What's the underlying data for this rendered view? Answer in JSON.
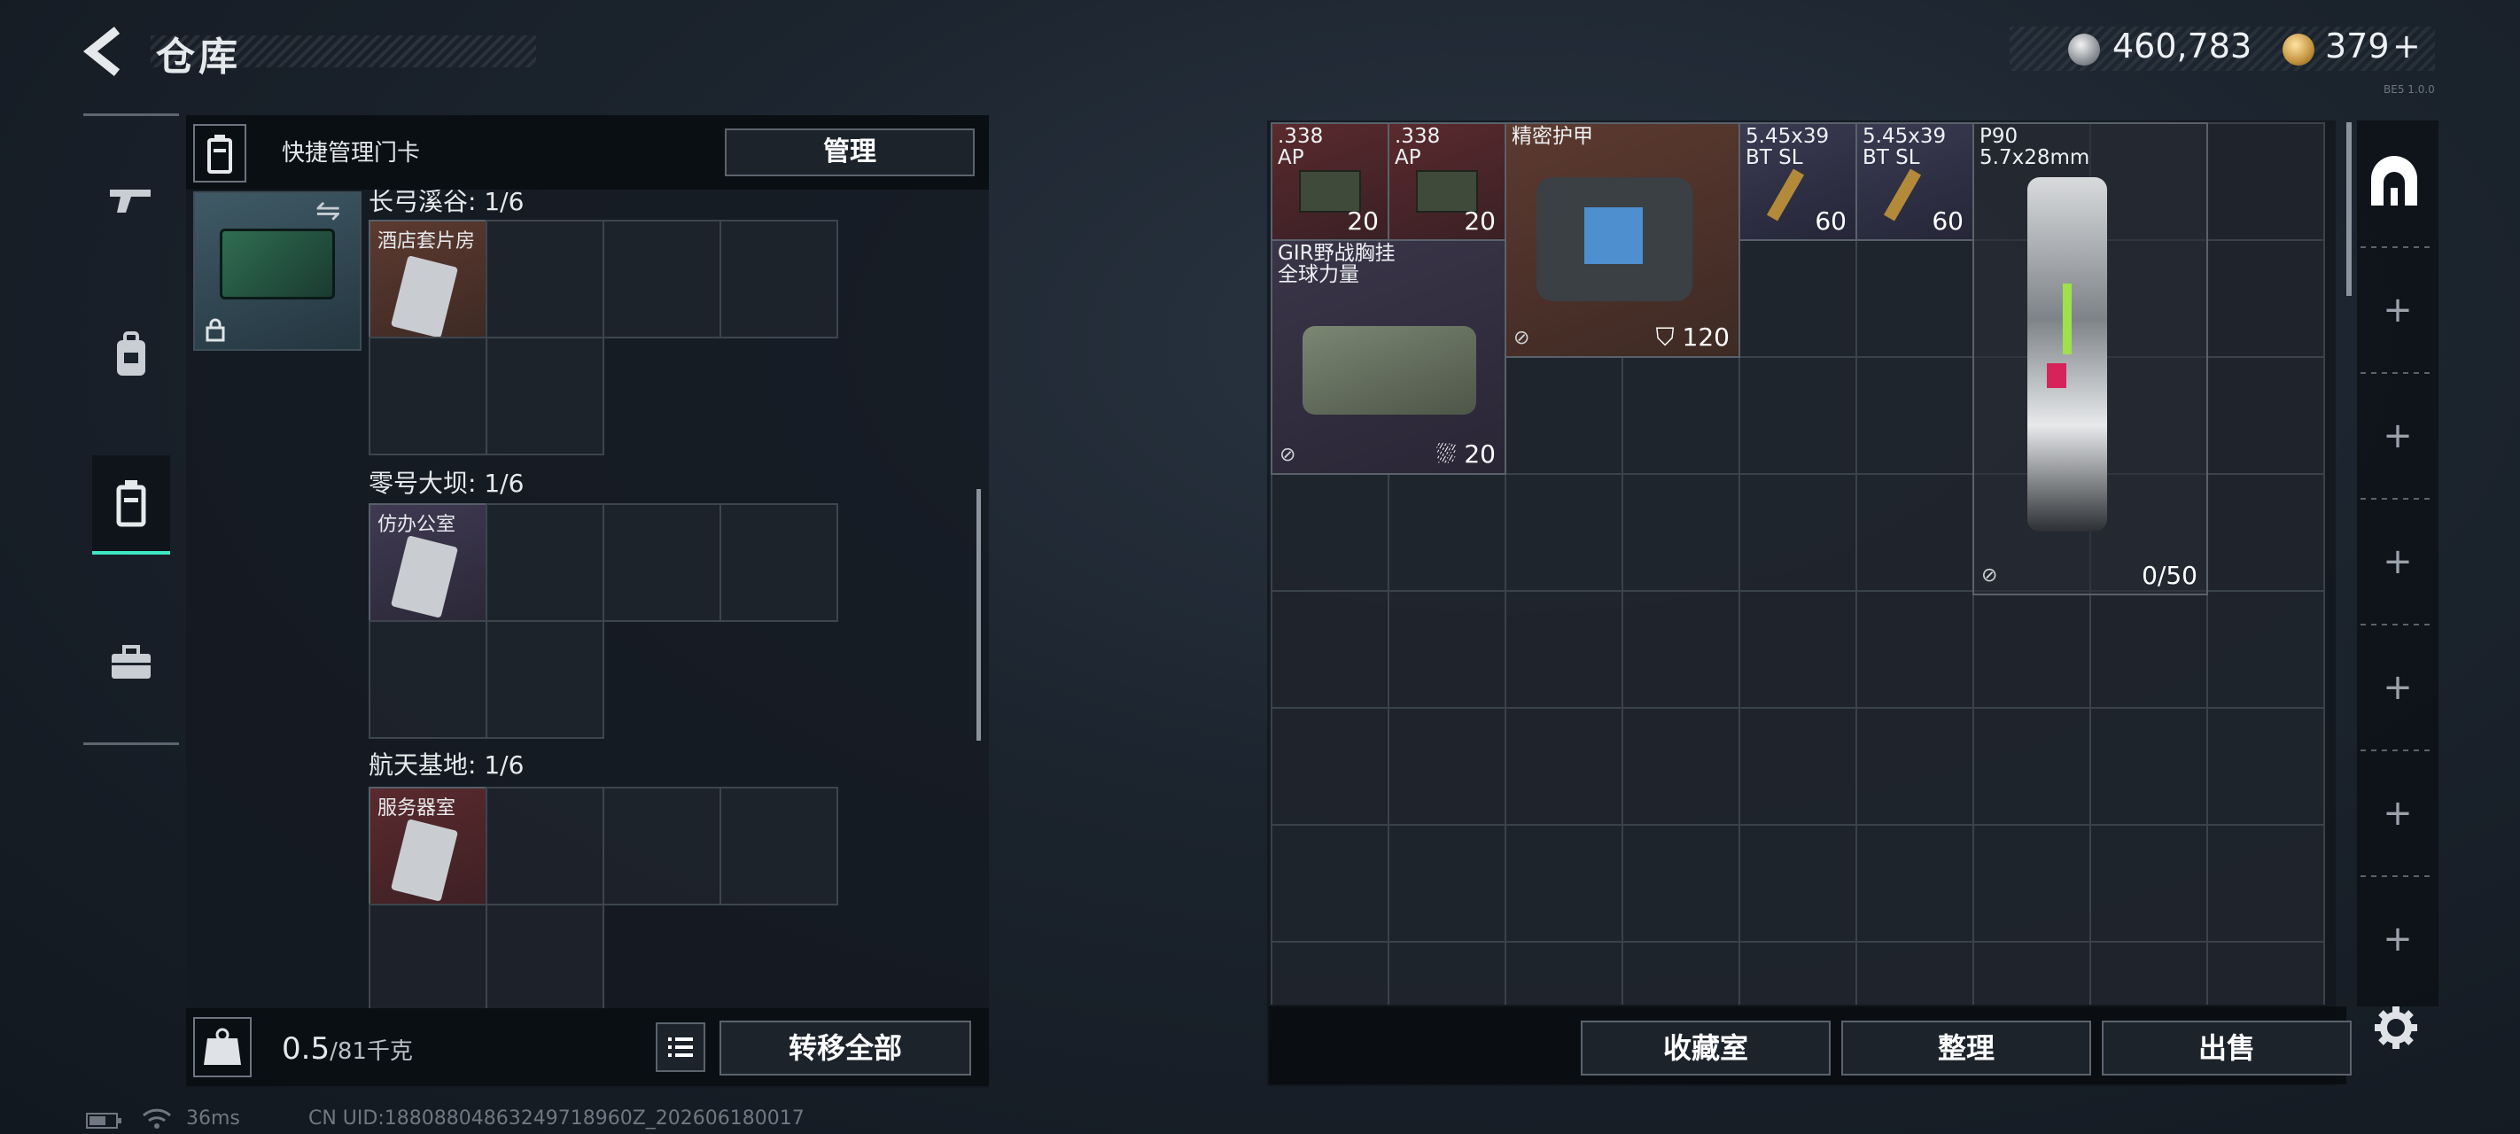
{
  "header": {
    "title": "仓库",
    "currency_silver": "460,783",
    "currency_gold": "379",
    "gold_plus": "+",
    "version": "BE5 1.0.0"
  },
  "left_panel": {
    "quick_label": "快捷管理门卡",
    "manage_label": "管理",
    "maps": [
      {
        "title": "长弓溪谷: 1/6",
        "key": "酒店套片房"
      },
      {
        "title": "零号大坝: 1/6",
        "key": "仿办公室"
      },
      {
        "title": "航天基地: 1/6",
        "key": "服务器室"
      }
    ],
    "weight_value": "0.5",
    "weight_unit": "/81千克",
    "transfer_label": "转移全部"
  },
  "stash": {
    "items": [
      {
        "name": ".338\nAP",
        "qty": "20"
      },
      {
        "name": ".338\nAP",
        "qty": "20"
      },
      {
        "name": "精密护甲",
        "qty": "120"
      },
      {
        "name": "5.45x39\nBT SL",
        "qty": "60"
      },
      {
        "name": "5.45x39\nBT SL",
        "qty": "60"
      },
      {
        "name": "P90\n5.7x28mm",
        "qty": "0/50"
      },
      {
        "name": "GIR野战胸挂\n全球力量",
        "qty": "20"
      }
    ],
    "buttons": {
      "collection": "收藏室",
      "sort": "整理",
      "sell": "出售"
    }
  },
  "status_bar": {
    "ping": "36ms",
    "uid": "CN UID:18808804863249718960Z_202606180017"
  },
  "colors": {
    "accent": "#3fe6c6",
    "ammo_red": "#5a2a2e",
    "armor_brown": "#5c3a30",
    "gear_purple": "#3a3548"
  }
}
